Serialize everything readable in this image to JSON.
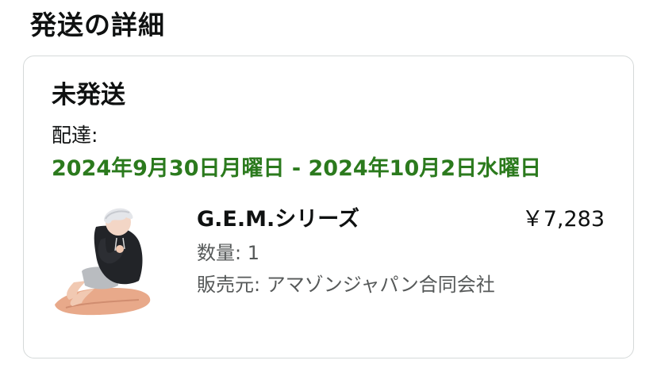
{
  "section": {
    "title": "発送の詳細"
  },
  "shipment": {
    "status": "未発送",
    "delivery_label": "配達:",
    "delivery_range": "2024年9月30日月曜日 - 2024年10月2日水曜日"
  },
  "item": {
    "image_icon": "product-figure-image",
    "name": "G.E.M.シリーズ",
    "price": "￥7,283",
    "quantity": "数量: 1",
    "seller": "販売元: アマゾンジャパン合同会社"
  },
  "colors": {
    "delivery_green": "#2b7a1d",
    "secondary_text": "#565959",
    "card_border": "#d5d9d9"
  }
}
